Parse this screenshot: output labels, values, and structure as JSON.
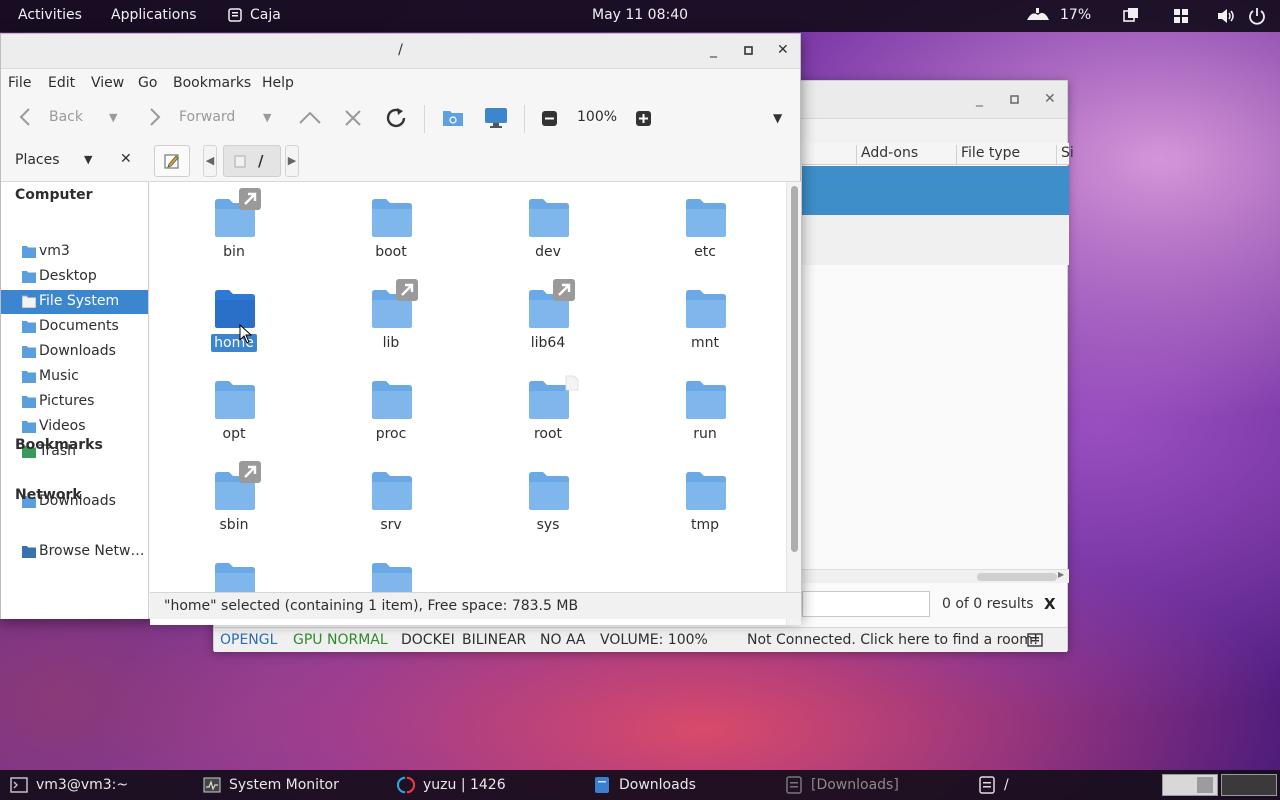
{
  "topbar": {
    "activities": "Activities",
    "applications": "Applications",
    "app_name": "Caja",
    "clock": "May 11  08:40",
    "battery": "17%"
  },
  "bg_window": {
    "columns": [
      "Add-ons",
      "File type",
      "Si"
    ],
    "results": "0 of 0 results",
    "close_search": "X",
    "status": {
      "api": "OPENGL",
      "gpu": "GPU NORMAL",
      "docked": "DOCKEI",
      "filter": "BILINEAR",
      "aa": "NO AA",
      "volume": "VOLUME: 100%",
      "network": "Not Connected. Click here to find a room!"
    },
    "colors": {
      "gpu": "#2e8b2e",
      "api": "#2a6fb5"
    }
  },
  "caja": {
    "title": "/",
    "menu": [
      "File",
      "Edit",
      "View",
      "Go",
      "Bookmarks",
      "Help"
    ],
    "toolbar": {
      "back": "Back",
      "forward": "Forward",
      "zoom": "100%"
    },
    "places_label": "Places",
    "crumb": "/",
    "sidebar": {
      "computer_head": "Computer",
      "computer_items": [
        "vm3",
        "Desktop",
        "File System",
        "Documents",
        "Downloads",
        "Music",
        "Pictures",
        "Videos",
        "Trash"
      ],
      "active_item": "File System",
      "bookmarks_head": "Bookmarks",
      "bookmark_items": [
        "Downloads"
      ],
      "network_head": "Network",
      "network_items": [
        "Browse Netw…"
      ]
    },
    "files": [
      {
        "name": "bin",
        "link": true
      },
      {
        "name": "boot",
        "link": false
      },
      {
        "name": "dev",
        "link": false
      },
      {
        "name": "etc",
        "link": false
      },
      {
        "name": "home",
        "link": false,
        "selected": true
      },
      {
        "name": "lib",
        "link": true
      },
      {
        "name": "lib64",
        "link": true
      },
      {
        "name": "mnt",
        "link": false
      },
      {
        "name": "opt",
        "link": false
      },
      {
        "name": "proc",
        "link": false
      },
      {
        "name": "root",
        "link": false
      },
      {
        "name": "run",
        "link": false
      },
      {
        "name": "sbin",
        "link": true
      },
      {
        "name": "srv",
        "link": false
      },
      {
        "name": "sys",
        "link": false
      },
      {
        "name": "tmp",
        "link": false
      },
      {
        "name": "",
        "link": false
      },
      {
        "name": "",
        "link": false
      }
    ],
    "status": "\"home\" selected (containing 1 item), Free space: 783.5 MB",
    "colors": {
      "folder": "#6aa8e6",
      "folder_selected": "#2f7ad6",
      "selection": "#3c86cf"
    }
  },
  "panel": {
    "tasks": [
      {
        "label": "vm3@vm3:~",
        "icon": "terminal-icon"
      },
      {
        "label": "System Monitor",
        "icon": "system-monitor-icon"
      },
      {
        "label": "yuzu | 1426",
        "icon": "yuzu-icon"
      },
      {
        "label": "Downloads",
        "icon": "folder-icon"
      },
      {
        "label": "[Downloads]",
        "icon": "window-icon",
        "dim": true
      },
      {
        "label": "/",
        "icon": "window-icon"
      }
    ]
  }
}
